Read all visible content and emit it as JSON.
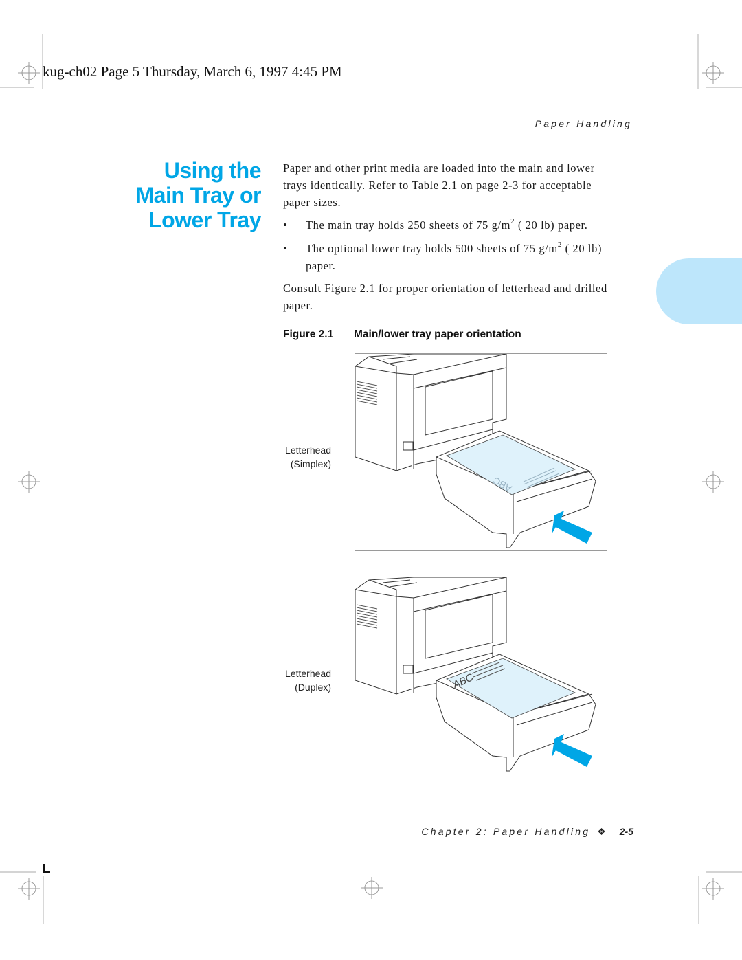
{
  "header": {
    "stamp": "kug-ch02  Page 5  Thursday, March 6, 1997  4:45 PM",
    "running_head": "Paper Handling"
  },
  "section": {
    "title_lines": [
      "Using the",
      "Main Tray or",
      "Lower Tray"
    ],
    "intro": "Paper and other print media are loaded into the main and lower trays identically. Refer to Table 2.1 on page 2-3 for acceptable paper sizes.",
    "bullets": [
      {
        "text_before": "The main tray holds 250 sheets of 75 g/m",
        "sup": "2",
        "text_after": " ( 20 lb) paper."
      },
      {
        "text_before": "The optional lower tray holds 500 sheets of 75 g/m",
        "sup": "2",
        "text_after": " ( 20 lb) paper."
      }
    ],
    "bullet_glyph": "•",
    "consult": "Consult Figure 2.1 for proper orientation of letterhead and drilled paper."
  },
  "figure": {
    "number": "Figure 2.1",
    "caption": "Main/lower tray paper orientation",
    "panels": [
      {
        "label_line1": "Letterhead",
        "label_line2": "(Simplex)",
        "paper_text": "ABC",
        "orientation": "simplex"
      },
      {
        "label_line1": "Letterhead",
        "label_line2": "(Duplex)",
        "paper_text": "ABC",
        "orientation": "duplex"
      }
    ]
  },
  "footer": {
    "chapter": "Chapter 2: Paper Handling",
    "diamond": "❖",
    "page": "2-5"
  },
  "colors": {
    "heading_blue": "#00a6e6",
    "tab_blue": "#bde6fb",
    "paper_blue": "#dff2fb",
    "arrow_blue": "#00a6e6"
  }
}
